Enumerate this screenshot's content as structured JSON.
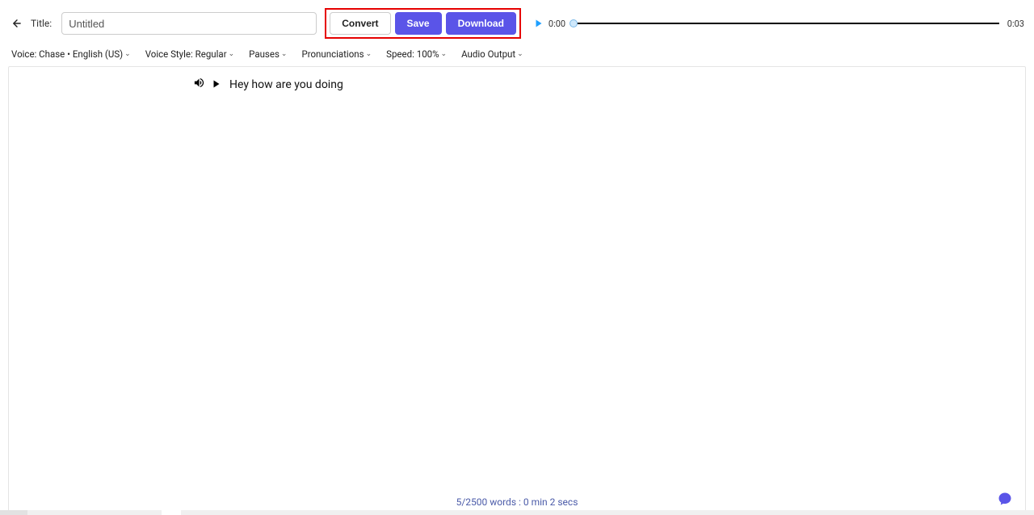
{
  "header": {
    "title_label": "Title:",
    "title_value": "Untitled",
    "buttons": {
      "convert": "Convert",
      "save": "Save",
      "download": "Download"
    },
    "player": {
      "current_time": "0:00",
      "total_time": "0:03"
    }
  },
  "options": {
    "voice": "Voice: Chase • English (US)",
    "voice_style": "Voice Style: Regular",
    "pauses": "Pauses",
    "pronunciations": "Pronunciations",
    "speed": "Speed: 100%",
    "audio_output": "Audio Output"
  },
  "editor": {
    "line_text": "Hey how are you doing"
  },
  "footer": {
    "status": "5/2500 words : 0 min 2 secs"
  }
}
